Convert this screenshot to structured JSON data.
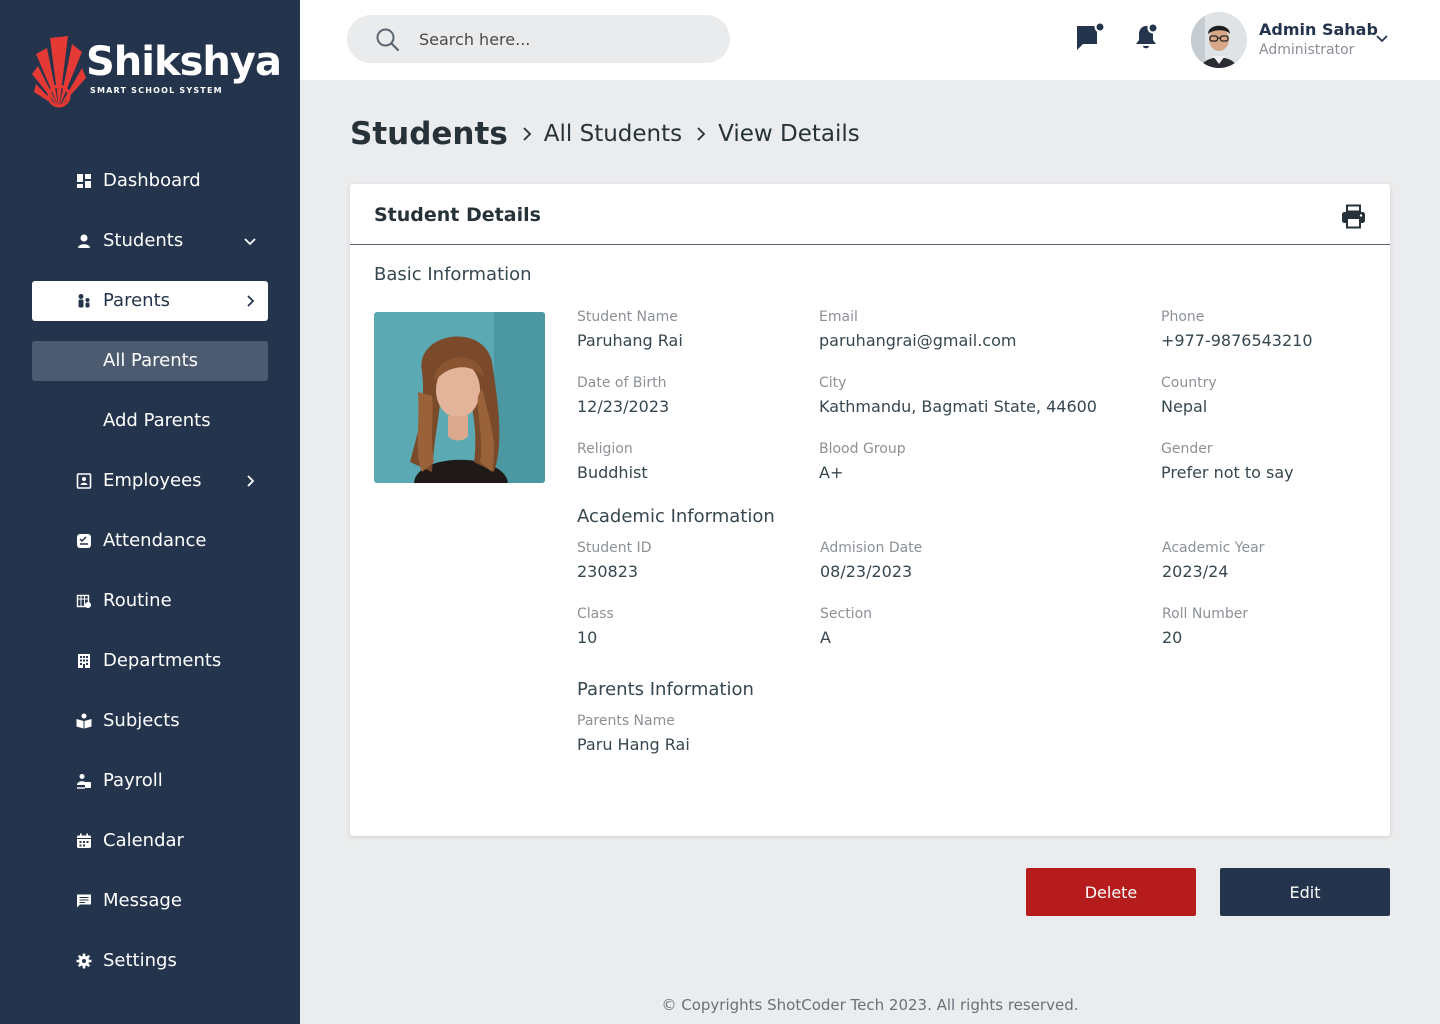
{
  "brand": {
    "name": "Shikshya",
    "tagline": "SMART SCHOOL SYSTEM",
    "accent": "#e53935",
    "sidebar_bg": "#24344c"
  },
  "sidebar": {
    "items": [
      {
        "label": "Dashboard",
        "icon": "dashboard-icon"
      },
      {
        "label": "Students",
        "icon": "student-icon",
        "chevron": "down"
      },
      {
        "label": "Parents",
        "icon": "parents-icon",
        "chevron": "right",
        "active": true
      },
      {
        "label": "All Parents",
        "sub": true,
        "active": true
      },
      {
        "label": "Add Parents",
        "sub": true
      },
      {
        "label": "Employees",
        "icon": "employees-icon",
        "chevron": "right"
      },
      {
        "label": "Attendance",
        "icon": "attendance-icon"
      },
      {
        "label": "Routine",
        "icon": "routine-icon"
      },
      {
        "label": "Departments",
        "icon": "departments-icon"
      },
      {
        "label": "Subjects",
        "icon": "subjects-icon"
      },
      {
        "label": "Payroll",
        "icon": "payroll-icon"
      },
      {
        "label": "Calendar",
        "icon": "calendar-icon"
      },
      {
        "label": "Message",
        "icon": "message-icon"
      },
      {
        "label": "Settings",
        "icon": "gear-icon"
      }
    ]
  },
  "header": {
    "search_placeholder": "Search here...",
    "user": {
      "name": "Admin Sahab",
      "role": "Administrator"
    }
  },
  "breadcrumb": {
    "root": "Students",
    "items": [
      "All Students",
      "View Details"
    ]
  },
  "card": {
    "title": "Student Details",
    "basic": {
      "title": "Basic Information",
      "fields": [
        {
          "label": "Student Name",
          "value": "Paruhang Rai"
        },
        {
          "label": "Email",
          "value": "paruhangrai@gmail.com"
        },
        {
          "label": "Phone",
          "value": "+977-9876543210"
        },
        {
          "label": "Date of Birth",
          "value": "12/23/2023"
        },
        {
          "label": "City",
          "value": "Kathmandu, Bagmati State, 44600"
        },
        {
          "label": "Country",
          "value": "Nepal"
        },
        {
          "label": "Religion",
          "value": "Buddhist"
        },
        {
          "label": "Blood Group",
          "value": "A+"
        },
        {
          "label": "Gender",
          "value": "Prefer not to say"
        }
      ]
    },
    "academic": {
      "title": "Academic Information",
      "fields": [
        {
          "label": "Student ID",
          "value": "230823"
        },
        {
          "label": "Admision Date",
          "value": "08/23/2023"
        },
        {
          "label": "Academic Year",
          "value": "2023/24"
        },
        {
          "label": "Class",
          "value": "10"
        },
        {
          "label": "Section",
          "value": "A"
        },
        {
          "label": "Roll Number",
          "value": "20"
        }
      ]
    },
    "parents": {
      "title": "Parents Information",
      "fields": [
        {
          "label": "Parents Name",
          "value": "Paru Hang Rai"
        }
      ]
    }
  },
  "actions": {
    "delete": "Delete",
    "edit": "Edit",
    "delete_color": "#b71c1c",
    "edit_color": "#24344c"
  },
  "footer": "© Copyrights ShotCoder Tech 2023. All rights reserved."
}
